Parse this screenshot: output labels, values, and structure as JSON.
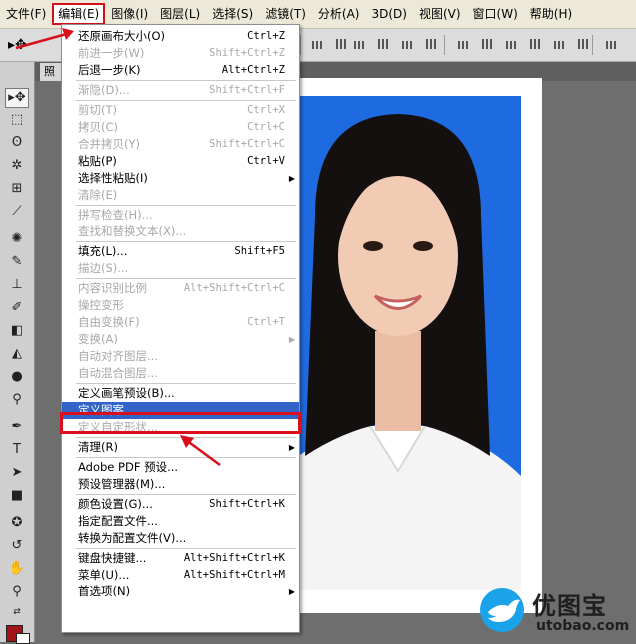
{
  "menubar": {
    "items": [
      {
        "label": "文件(F)"
      },
      {
        "label": "编辑(E)"
      },
      {
        "label": "图像(I)"
      },
      {
        "label": "图层(L)"
      },
      {
        "label": "选择(S)"
      },
      {
        "label": "滤镜(T)"
      },
      {
        "label": "分析(A)"
      },
      {
        "label": "3D(D)"
      },
      {
        "label": "视图(V)"
      },
      {
        "label": "窗口(W)"
      },
      {
        "label": "帮助(H)"
      }
    ]
  },
  "doc_tab": {
    "label": "照"
  },
  "edit_menu": {
    "groups": [
      [
        {
          "label": "还原画布大小(O)",
          "shortcut": "Ctrl+Z",
          "disabled": false
        },
        {
          "label": "前进一步(W)",
          "shortcut": "Shift+Ctrl+Z",
          "disabled": true
        },
        {
          "label": "后退一步(K)",
          "shortcut": "Alt+Ctrl+Z",
          "disabled": false
        }
      ],
      [
        {
          "label": "渐隐(D)...",
          "shortcut": "Shift+Ctrl+F",
          "disabled": true
        }
      ],
      [
        {
          "label": "剪切(T)",
          "shortcut": "Ctrl+X",
          "disabled": true
        },
        {
          "label": "拷贝(C)",
          "shortcut": "Ctrl+C",
          "disabled": true
        },
        {
          "label": "合并拷贝(Y)",
          "shortcut": "Shift+Ctrl+C",
          "disabled": true
        },
        {
          "label": "粘贴(P)",
          "shortcut": "Ctrl+V",
          "disabled": false
        },
        {
          "label": "选择性粘贴(I)",
          "shortcut": "",
          "disabled": false,
          "submenu": true
        },
        {
          "label": "清除(E)",
          "shortcut": "",
          "disabled": true
        }
      ],
      [
        {
          "label": "拼写检查(H)...",
          "shortcut": "",
          "disabled": true
        },
        {
          "label": "查找和替换文本(X)...",
          "shortcut": "",
          "disabled": true
        }
      ],
      [
        {
          "label": "填充(L)...",
          "shortcut": "Shift+F5",
          "disabled": false
        },
        {
          "label": "描边(S)...",
          "shortcut": "",
          "disabled": true
        }
      ],
      [
        {
          "label": "内容识别比例",
          "shortcut": "Alt+Shift+Ctrl+C",
          "disabled": true
        },
        {
          "label": "操控变形",
          "shortcut": "",
          "disabled": true
        },
        {
          "label": "自由变换(F)",
          "shortcut": "Ctrl+T",
          "disabled": true
        },
        {
          "label": "变换(A)",
          "shortcut": "",
          "disabled": true,
          "submenu": true
        },
        {
          "label": "自动对齐图层...",
          "shortcut": "",
          "disabled": true
        },
        {
          "label": "自动混合图层...",
          "shortcut": "",
          "disabled": true
        }
      ],
      [
        {
          "label": "定义画笔预设(B)...",
          "shortcut": "",
          "disabled": false
        },
        {
          "label": "定义图案...",
          "shortcut": "",
          "disabled": false,
          "highlighted": true
        },
        {
          "label": "定义自定形状...",
          "shortcut": "",
          "disabled": true
        }
      ],
      [
        {
          "label": "清理(R)",
          "shortcut": "",
          "disabled": false,
          "submenu": true
        }
      ],
      [
        {
          "label": "Adobe PDF 预设...",
          "shortcut": "",
          "disabled": false
        },
        {
          "label": "预设管理器(M)...",
          "shortcut": "",
          "disabled": false
        }
      ],
      [
        {
          "label": "颜色设置(G)...",
          "shortcut": "Shift+Ctrl+K",
          "disabled": false
        },
        {
          "label": "指定配置文件...",
          "shortcut": "",
          "disabled": false
        },
        {
          "label": "转换为配置文件(V)...",
          "shortcut": "",
          "disabled": false
        }
      ],
      [
        {
          "label": "键盘快捷键...",
          "shortcut": "Alt+Shift+Ctrl+K",
          "disabled": false
        },
        {
          "label": "菜单(U)...",
          "shortcut": "Alt+Shift+Ctrl+M",
          "disabled": false
        },
        {
          "label": "首选项(N)",
          "shortcut": "",
          "disabled": false,
          "submenu": true
        }
      ]
    ]
  },
  "watermark": {
    "brand": "优图宝",
    "url": "utobao.com"
  },
  "colors": {
    "menu_highlight": "#3163c9",
    "annotation_red": "#d8101c",
    "photo_background": "#1e6ae0",
    "foreground_swatch": "#a4131a"
  }
}
